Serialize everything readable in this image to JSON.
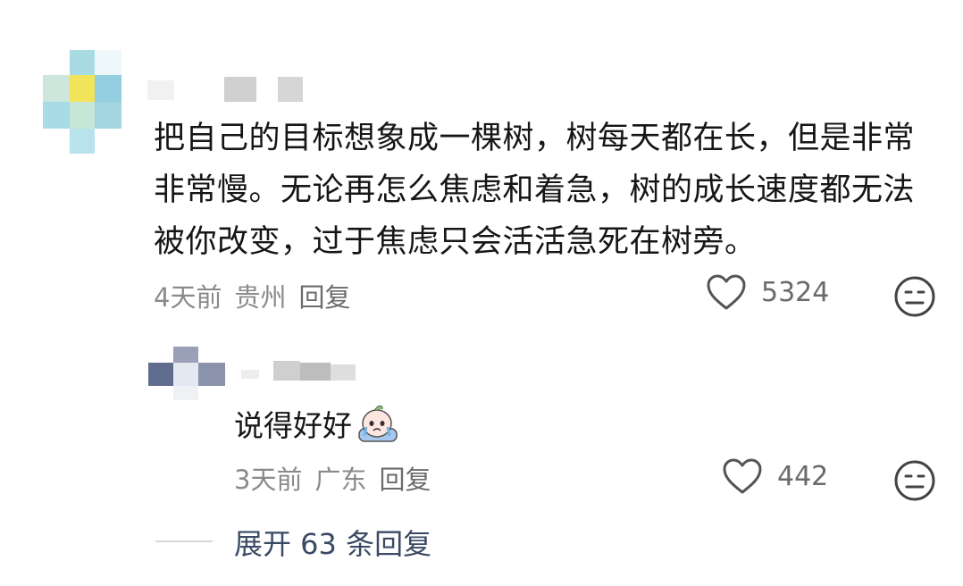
{
  "main_comment": {
    "text": "把自己的目标想象成一棵树，树每天都在长，但是非常非常慢。无论再怎么焦虑和着急，树的成长速度都无法被你改变，过于焦虑只会活活急死在树旁。",
    "time": "4天前",
    "location": "贵州",
    "reply_label": "回复",
    "likes": "5324"
  },
  "reply_comment": {
    "text": "说得好好",
    "time": "3天前",
    "location": "广东",
    "reply_label": "回复",
    "likes": "442"
  },
  "expand": {
    "label": "展开 63 条回复"
  },
  "icons": {
    "like": "heart-icon",
    "dislike": "meh-face-icon",
    "emoji": "crying-peach-emoji-icon"
  },
  "colors": {
    "meta_text": "#8a8a8a",
    "expand_text": "#3a4a64"
  }
}
